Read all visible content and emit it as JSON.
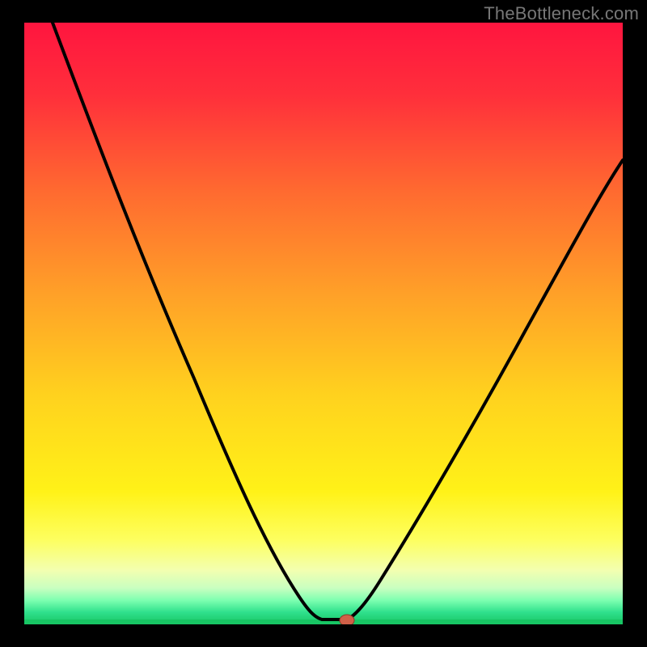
{
  "watermark": "TheBottleneck.com",
  "colors": {
    "frame_bg": "#000000",
    "curve": "#000000",
    "marker_fill": "#d06048",
    "marker_stroke": "#8a3a28",
    "gradient_stops": [
      {
        "offset": 0.0,
        "color": "#ff153f"
      },
      {
        "offset": 0.12,
        "color": "#ff2f3b"
      },
      {
        "offset": 0.28,
        "color": "#ff6a30"
      },
      {
        "offset": 0.45,
        "color": "#ffa028"
      },
      {
        "offset": 0.62,
        "color": "#ffd21e"
      },
      {
        "offset": 0.78,
        "color": "#fff218"
      },
      {
        "offset": 0.86,
        "color": "#fdff60"
      },
      {
        "offset": 0.91,
        "color": "#f3ffb0"
      },
      {
        "offset": 0.94,
        "color": "#c8ffc0"
      },
      {
        "offset": 0.96,
        "color": "#7dffb0"
      },
      {
        "offset": 0.98,
        "color": "#2fe08c"
      },
      {
        "offset": 1.0,
        "color": "#18c664"
      }
    ]
  },
  "chart_data": {
    "type": "line",
    "title": "",
    "xlabel": "",
    "ylabel": "",
    "xlim": [
      0,
      100
    ],
    "ylim": [
      0,
      100
    ],
    "grid": false,
    "legend": false,
    "series": [
      {
        "name": "bottleneck-curve",
        "x": [
          5,
          12,
          20,
          28,
          35,
          42,
          46,
          50,
          52,
          54,
          57,
          63,
          72,
          82,
          90,
          100
        ],
        "y": [
          100,
          84,
          65,
          48,
          33,
          18,
          8,
          2,
          0,
          0,
          3,
          12,
          30,
          50,
          65,
          77
        ]
      }
    ],
    "annotations": [
      {
        "name": "optimum-marker",
        "x": 54,
        "y": 0
      }
    ]
  }
}
